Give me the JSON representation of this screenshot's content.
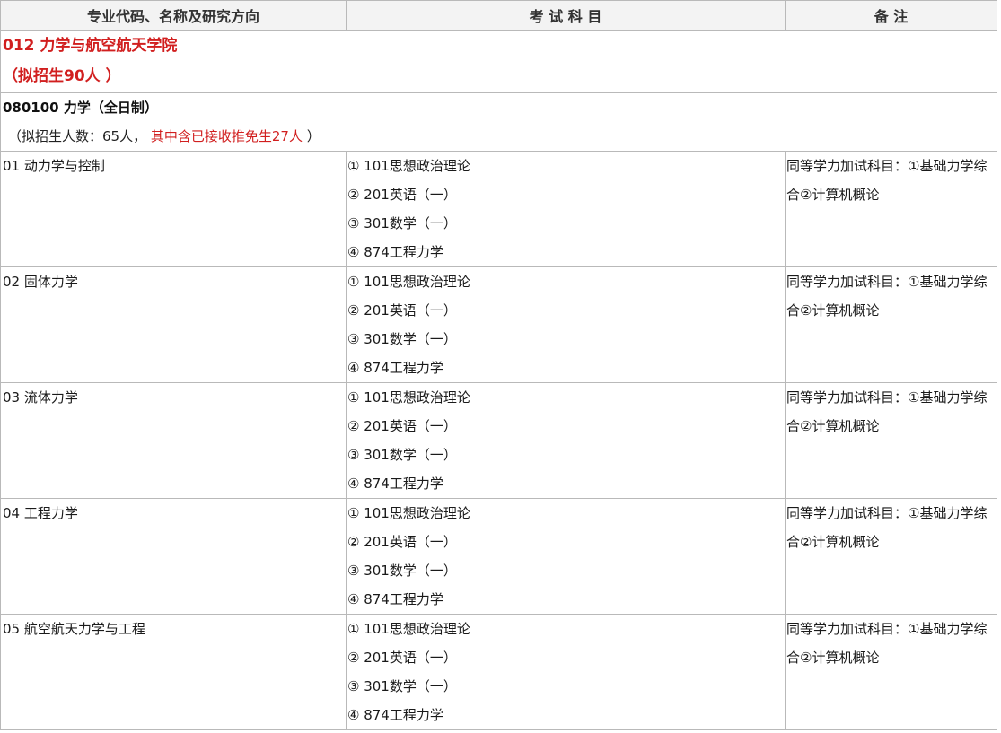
{
  "header": {
    "col1": "专业代码、名称及研究方向",
    "col2": "考 试 科 目",
    "col3": "备 注"
  },
  "college": {
    "line1": "012 力学与航空航天学院",
    "line2": "（拟招生90人 ）"
  },
  "major": {
    "title": "080100 力学（全日制）",
    "quota_prefix": "（拟招生人数：65人，",
    "quota_red": " 其中含已接收推免生27人",
    "quota_suffix": " ）"
  },
  "rows": [
    {
      "direction": "01 动力学与控制",
      "subjects": [
        "① 101思想政治理论",
        "② 201英语（一）",
        "③ 301数学（一）",
        "④ 874工程力学"
      ],
      "note": "同等学力加试科目：①基础力学综合②计算机概论"
    },
    {
      "direction": "02 固体力学",
      "subjects": [
        "① 101思想政治理论",
        "② 201英语（一）",
        "③ 301数学（一）",
        "④ 874工程力学"
      ],
      "note": "同等学力加试科目：①基础力学综合②计算机概论"
    },
    {
      "direction": "03 流体力学",
      "subjects": [
        "① 101思想政治理论",
        "② 201英语（一）",
        "③ 301数学（一）",
        "④ 874工程力学"
      ],
      "note": "同等学力加试科目：①基础力学综合②计算机概论"
    },
    {
      "direction": "04 工程力学",
      "subjects": [
        "① 101思想政治理论",
        "② 201英语（一）",
        "③ 301数学（一）",
        "④ 874工程力学"
      ],
      "note": "同等学力加试科目：①基础力学综合②计算机概论"
    },
    {
      "direction": "05 航空航天力学与工程",
      "subjects": [
        "① 101思想政治理论",
        "② 201英语（一）",
        "③ 301数学（一）",
        "④ 874工程力学"
      ],
      "note": "同等学力加试科目：①基础力学综合②计算机概论"
    }
  ]
}
